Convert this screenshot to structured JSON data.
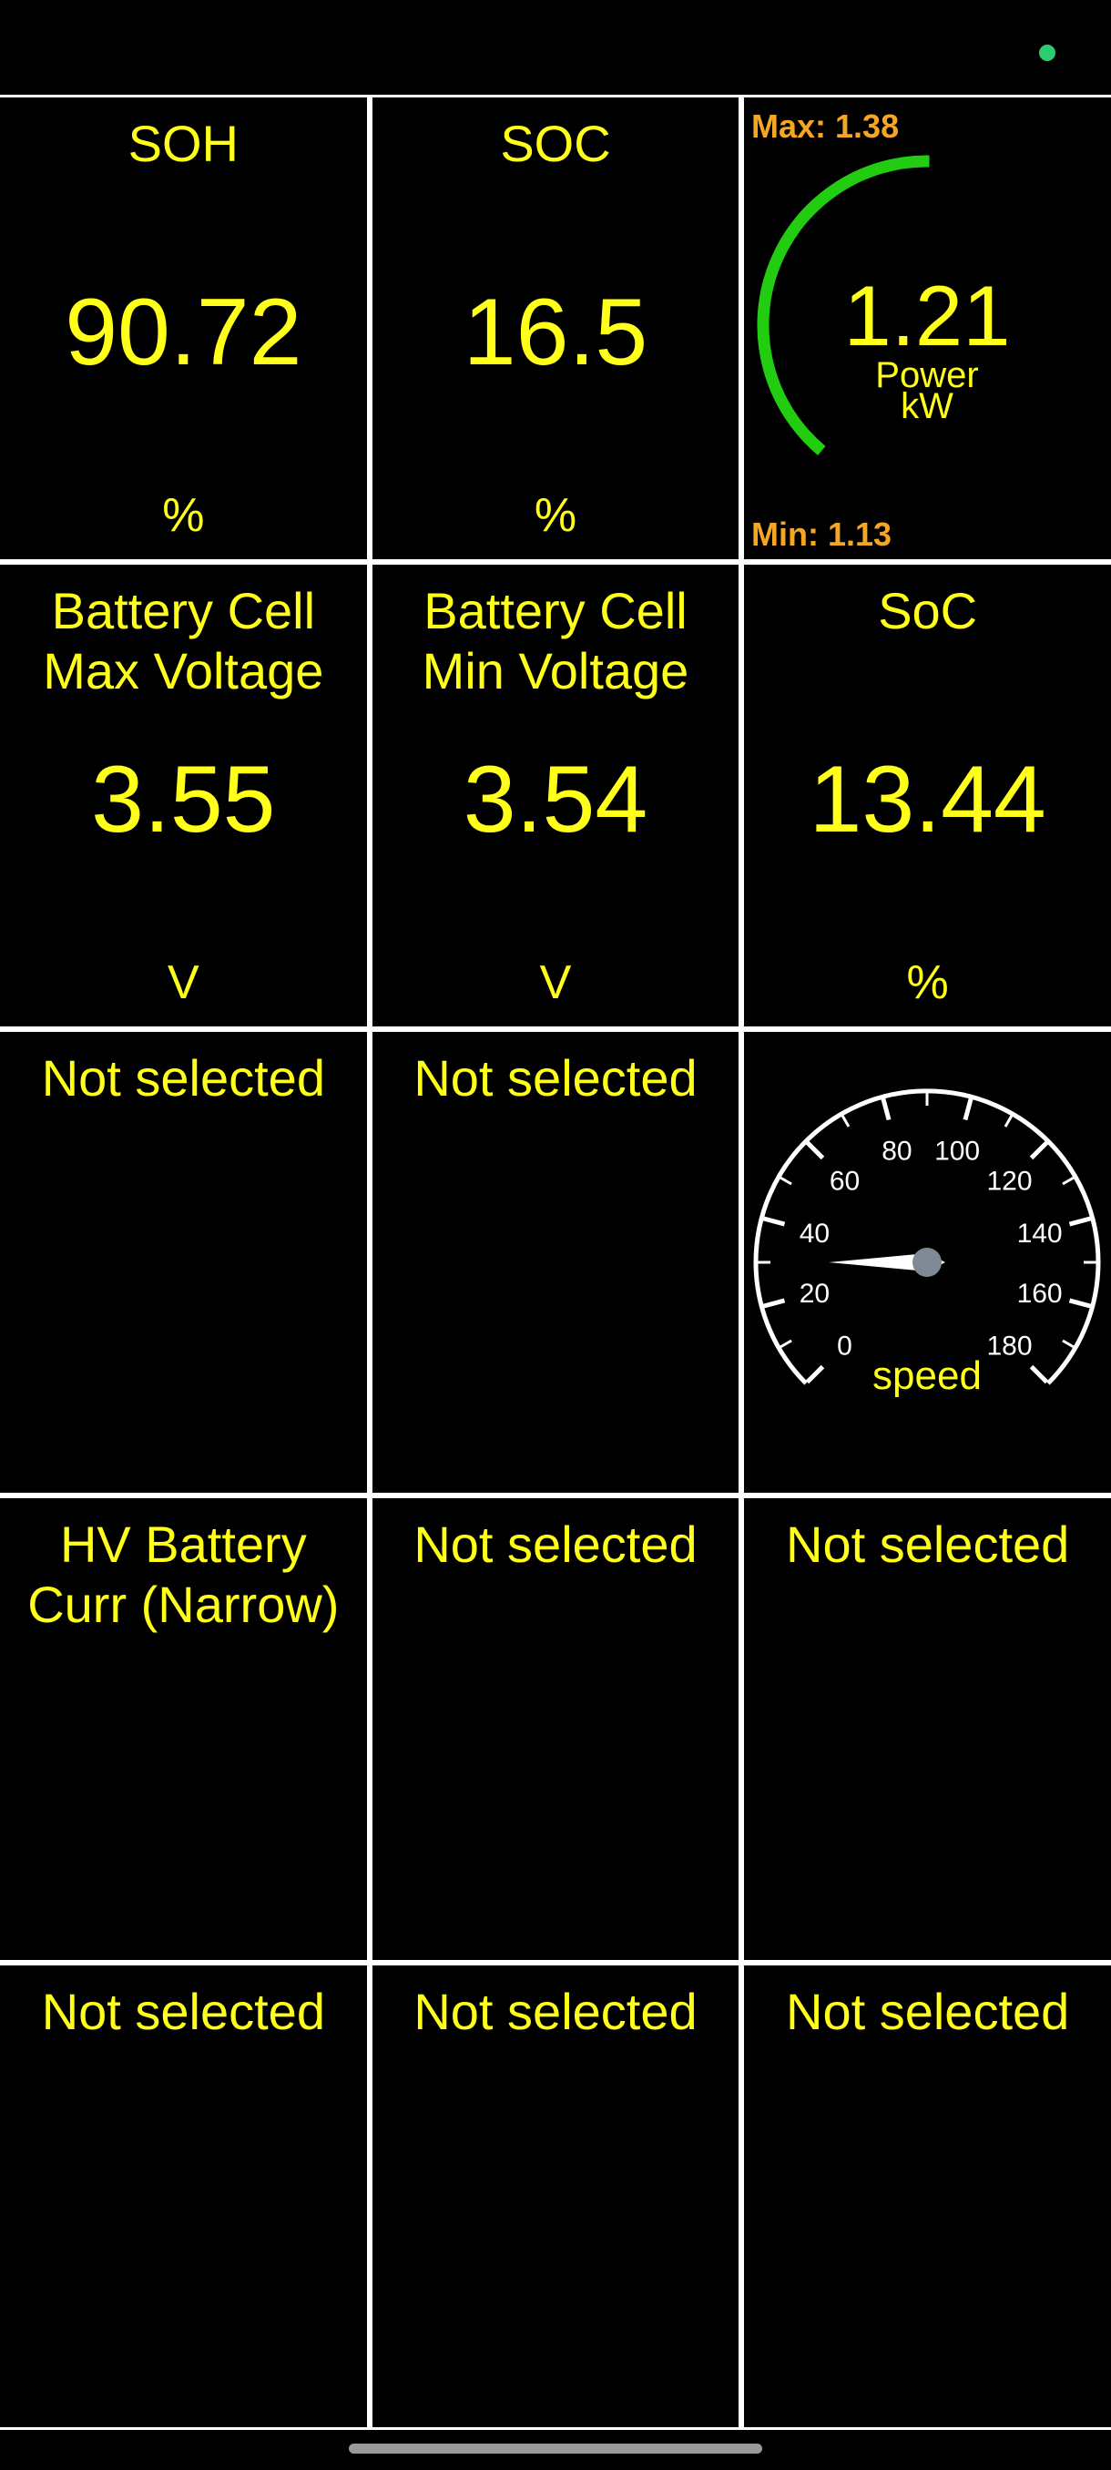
{
  "colors": {
    "accent_text": "#ffff1a",
    "gauge_arc": "#22cc11",
    "gauge_minmax": "#f5a623",
    "status_dot": "#2ecc71"
  },
  "status_icon": "status-dot-icon",
  "tiles": [
    {
      "label": "SOH",
      "value": "90.72",
      "unit": "%"
    },
    {
      "label": "SOC",
      "value": "16.5",
      "unit": "%"
    },
    {
      "max_label": "Max: 1.38",
      "value": "1.21",
      "label": "Power",
      "unit": "kW",
      "min_label": "Min: 1.13",
      "level_fraction": 0.55
    },
    {
      "label_line1": "Battery Cell",
      "label_line2": "Max Voltage",
      "value": "3.55",
      "unit": "V"
    },
    {
      "label_line1": "Battery Cell",
      "label_line2": "Min Voltage",
      "value": "3.54",
      "unit": "V"
    },
    {
      "label": "SoC",
      "value": "13.44",
      "unit": "%"
    },
    {
      "label": "Not selected"
    },
    {
      "label": "Not selected"
    },
    {
      "label": "speed",
      "ticks": [
        "0",
        "20",
        "40",
        "60",
        "80",
        "100",
        "120",
        "140",
        "160",
        "180"
      ],
      "current_value": 30
    },
    {
      "label_line1": "HV Battery",
      "label_line2": "Curr (Narrow)"
    },
    {
      "label": "Not selected"
    },
    {
      "label": "Not selected"
    },
    {
      "label": "Not selected"
    },
    {
      "label": "Not selected"
    },
    {
      "label": "Not selected"
    }
  ]
}
